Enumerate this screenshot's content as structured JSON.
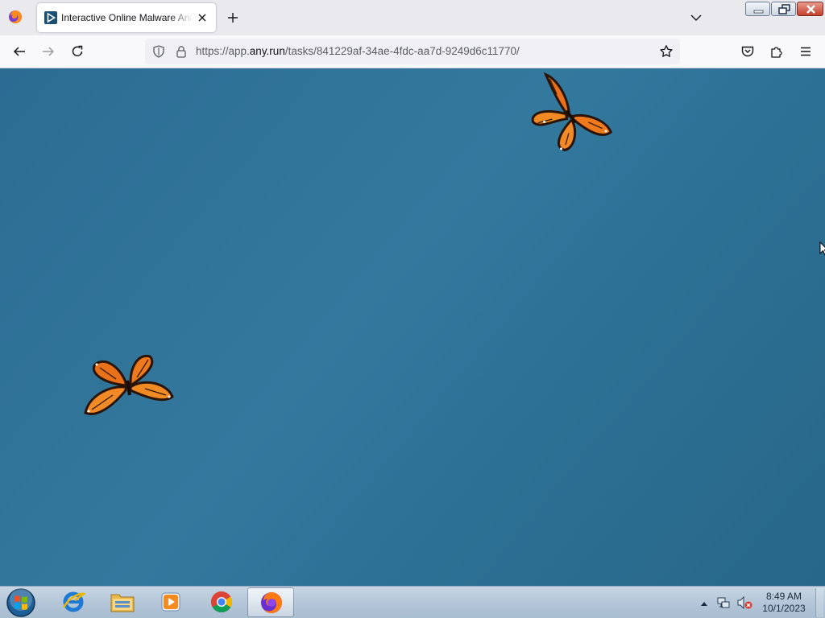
{
  "browser": {
    "tab": {
      "title": "Interactive Online Malware Analysis Sandbox - ANY.RUN",
      "favicon": "anyrun-play-icon"
    },
    "url": {
      "prefix": "https://app.",
      "host": "any.run",
      "path": "/tasks/841229af-34ae-4fdc-aa7d-9249d6c11770/"
    },
    "icons": {
      "app": "firefox-icon",
      "close_tab": "close-icon",
      "new_tab": "plus-icon",
      "tab_list": "chevron-down-icon",
      "back": "back-arrow-icon",
      "forward": "forward-arrow-icon",
      "reload": "reload-icon",
      "tracking": "shield-icon",
      "lock": "lock-icon",
      "bookmark": "star-icon",
      "pocket": "pocket-icon",
      "extensions": "puzzle-icon",
      "menu": "hamburger-menu-icon"
    },
    "window_buttons": [
      "minimize",
      "restore",
      "close"
    ]
  },
  "content": {
    "background_color": "#2f7196",
    "decorations": [
      "monarch-butterfly",
      "monarch-butterfly"
    ]
  },
  "taskbar": {
    "start_icon": "windows-start-orb-icon",
    "apps": [
      {
        "name": "internet-explorer-icon",
        "active": false
      },
      {
        "name": "file-explorer-icon",
        "active": false
      },
      {
        "name": "media-player-icon",
        "active": false
      },
      {
        "name": "chrome-icon",
        "active": false
      },
      {
        "name": "firefox-icon",
        "active": true
      }
    ],
    "tray_icons": [
      "show-hidden-icons-icon",
      "network-icon",
      "volume-muted-icon"
    ],
    "clock": {
      "time": "8:49 AM",
      "date": "10/1/2023"
    }
  }
}
